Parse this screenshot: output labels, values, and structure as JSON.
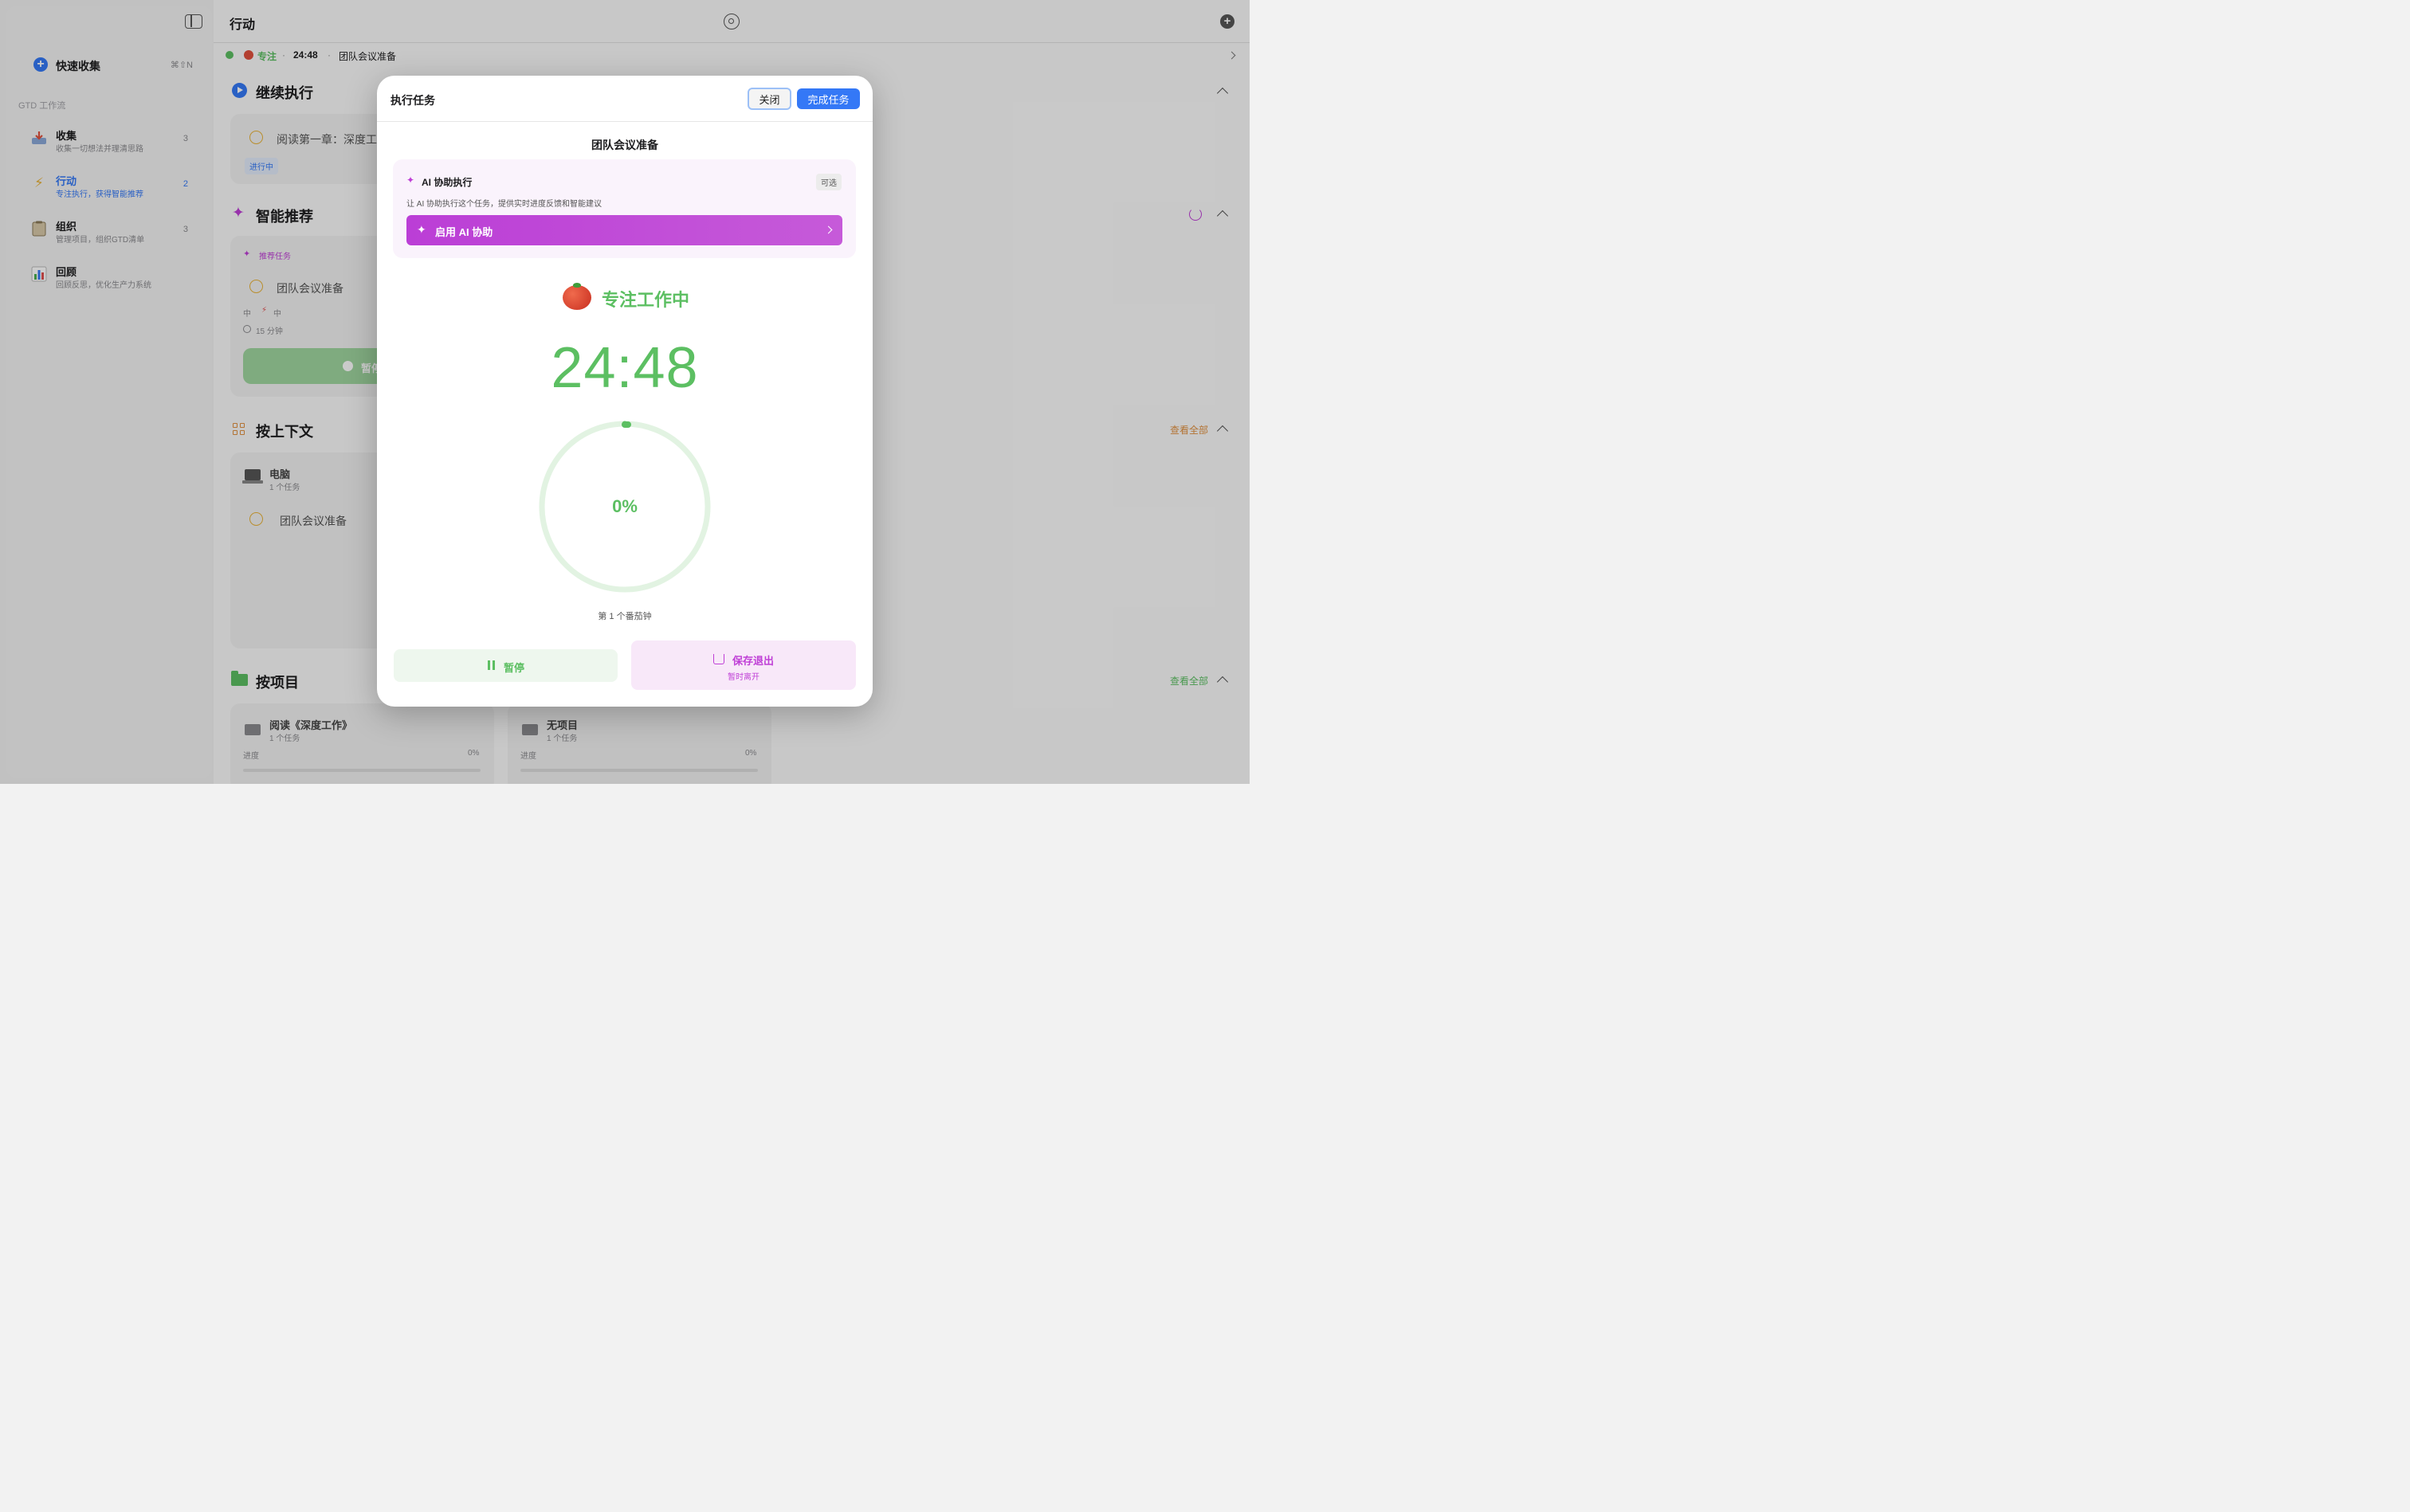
{
  "sidebar": {
    "quick_capture": {
      "label": "快速收集",
      "shortcut": "⌘⇧N"
    },
    "section_label": "GTD 工作流",
    "items": [
      {
        "label": "收集",
        "desc": "收集一切想法并理清思路",
        "count": "3"
      },
      {
        "label": "行动",
        "desc": "专注执行，获得智能推荐",
        "count": "2"
      },
      {
        "label": "组织",
        "desc": "管理项目，组织GTD清单",
        "count": "3"
      },
      {
        "label": "回顾",
        "desc": "回顾反思，优化生产力系统",
        "count": ""
      }
    ]
  },
  "header": {
    "title": "行动"
  },
  "status_bar": {
    "mode": "专注",
    "time": "24:48",
    "task": "团队会议准备"
  },
  "sections": {
    "continue": {
      "title": "继续执行",
      "task": "阅读第一章：深度工作",
      "badge": "进行中"
    },
    "smart": {
      "title": "智能推荐",
      "tag": "推荐任务",
      "task": "团队会议准备",
      "priority": "中",
      "energy": "中",
      "duration": "15 分钟",
      "pause_label": "暂停"
    },
    "context": {
      "title": "按上下文",
      "view_all": "查看全部",
      "group": "电脑",
      "group_count": "1 个任务",
      "task": "团队会议准备"
    },
    "project": {
      "title": "按项目",
      "view_all": "查看全部",
      "cards": [
        {
          "name": "阅读《深度工作》",
          "count": "1 个任务",
          "progress_label": "进度",
          "progress": "0%"
        },
        {
          "name": "无项目",
          "count": "1 个任务",
          "progress_label": "进度",
          "progress": "0%"
        }
      ]
    }
  },
  "modal": {
    "title": "执行任务",
    "close_label": "关闭",
    "complete_label": "完成任务",
    "task_name": "团队会议准备",
    "ai": {
      "title": "AI 协助执行",
      "badge": "可选",
      "desc": "让 AI 协助执行这个任务，提供实时进度反馈和智能建议",
      "button": "启用 AI 协助"
    },
    "focus_label": "专注工作中",
    "timer": "24:48",
    "progress": "0%",
    "progress_value": 0,
    "pomodoro_label": "第 1 个番茄钟",
    "pause_label": "暂停",
    "save_label": "保存退出",
    "save_sub": "暂时离开"
  },
  "colors": {
    "accent_blue": "#3478f6",
    "focus_green": "#5cbf62",
    "ai_purple": "#bf3fd6",
    "pending_orange": "#e8b23a"
  },
  "icons": [
    "sidebar-toggle-icon",
    "settings-icon",
    "add-icon",
    "tomato-icon",
    "sparkle-icon",
    "pause-icon",
    "save-exit-icon",
    "folder-icon",
    "laptop-icon",
    "refresh-icon"
  ]
}
